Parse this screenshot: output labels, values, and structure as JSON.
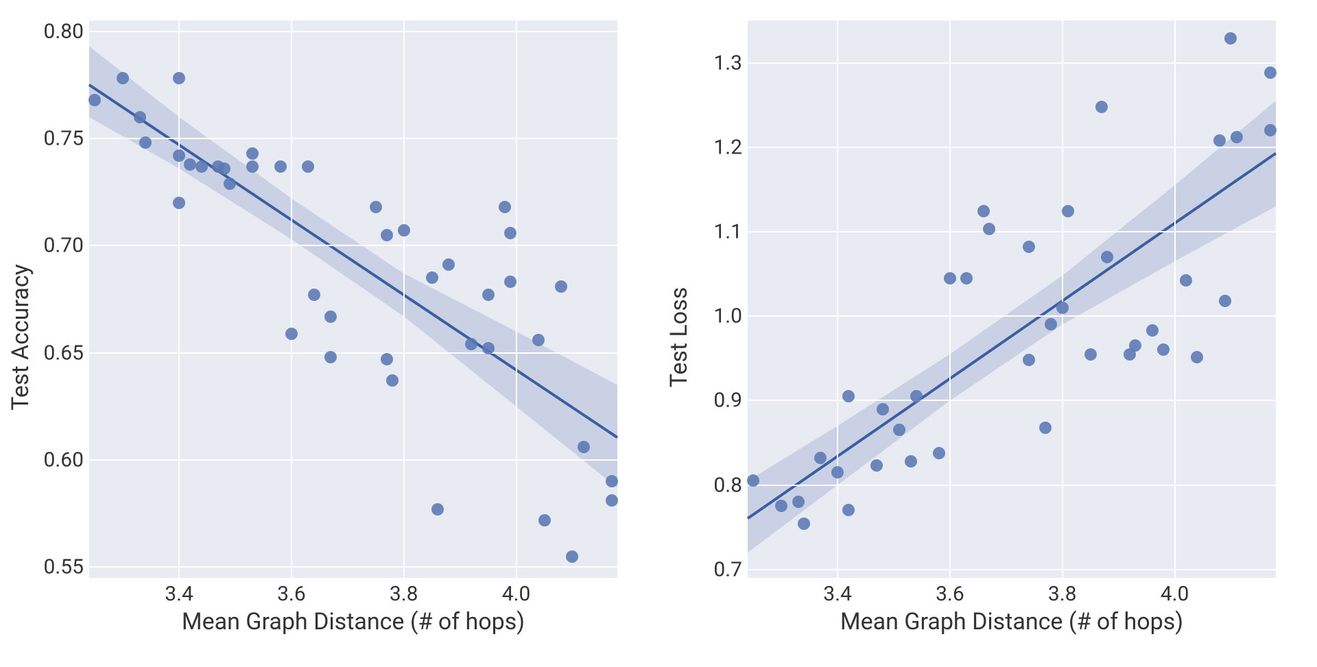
{
  "chart_data": [
    {
      "type": "scatter",
      "title": "",
      "xlabel": "Mean Graph Distance (# of hops)",
      "ylabel": "Test Accuracy",
      "xlim": [
        3.24,
        4.18
      ],
      "ylim": [
        0.545,
        0.805
      ],
      "xticks": [
        3.4,
        3.6,
        3.8,
        4.0
      ],
      "yticks": [
        0.55,
        0.6,
        0.65,
        0.7,
        0.75,
        0.8
      ],
      "xtick_labels": [
        "3.4",
        "3.6",
        "3.8",
        "4.0"
      ],
      "ytick_labels": [
        "0.55",
        "0.60",
        "0.65",
        "0.70",
        "0.75",
        "0.80"
      ],
      "regression": {
        "slope": -0.175,
        "intercept": 1.342
      },
      "ci_band": [
        {
          "x": 3.24,
          "lo": 0.76,
          "hi": 0.793
        },
        {
          "x": 3.4,
          "lo": 0.736,
          "hi": 0.76
        },
        {
          "x": 3.6,
          "lo": 0.703,
          "hi": 0.722
        },
        {
          "x": 3.8,
          "lo": 0.667,
          "hi": 0.687
        },
        {
          "x": 4.0,
          "lo": 0.625,
          "hi": 0.66
        },
        {
          "x": 4.18,
          "lo": 0.587,
          "hi": 0.635
        }
      ],
      "points": [
        {
          "x": 3.25,
          "y": 0.768
        },
        {
          "x": 3.3,
          "y": 0.778
        },
        {
          "x": 3.33,
          "y": 0.76
        },
        {
          "x": 3.34,
          "y": 0.748
        },
        {
          "x": 3.4,
          "y": 0.778
        },
        {
          "x": 3.4,
          "y": 0.742
        },
        {
          "x": 3.4,
          "y": 0.72
        },
        {
          "x": 3.42,
          "y": 0.738
        },
        {
          "x": 3.44,
          "y": 0.737
        },
        {
          "x": 3.47,
          "y": 0.737
        },
        {
          "x": 3.48,
          "y": 0.736
        },
        {
          "x": 3.49,
          "y": 0.729
        },
        {
          "x": 3.53,
          "y": 0.737
        },
        {
          "x": 3.53,
          "y": 0.743
        },
        {
          "x": 3.58,
          "y": 0.737
        },
        {
          "x": 3.6,
          "y": 0.659
        },
        {
          "x": 3.63,
          "y": 0.737
        },
        {
          "x": 3.64,
          "y": 0.677
        },
        {
          "x": 3.67,
          "y": 0.667
        },
        {
          "x": 3.67,
          "y": 0.648
        },
        {
          "x": 3.75,
          "y": 0.718
        },
        {
          "x": 3.77,
          "y": 0.705
        },
        {
          "x": 3.77,
          "y": 0.647
        },
        {
          "x": 3.78,
          "y": 0.637
        },
        {
          "x": 3.8,
          "y": 0.707
        },
        {
          "x": 3.85,
          "y": 0.685
        },
        {
          "x": 3.86,
          "y": 0.577
        },
        {
          "x": 3.88,
          "y": 0.691
        },
        {
          "x": 3.92,
          "y": 0.654
        },
        {
          "x": 3.95,
          "y": 0.677
        },
        {
          "x": 3.95,
          "y": 0.652
        },
        {
          "x": 3.98,
          "y": 0.718
        },
        {
          "x": 3.99,
          "y": 0.683
        },
        {
          "x": 3.99,
          "y": 0.706
        },
        {
          "x": 4.04,
          "y": 0.656
        },
        {
          "x": 4.05,
          "y": 0.572
        },
        {
          "x": 4.08,
          "y": 0.681
        },
        {
          "x": 4.1,
          "y": 0.555
        },
        {
          "x": 4.12,
          "y": 0.606
        },
        {
          "x": 4.17,
          "y": 0.59
        },
        {
          "x": 4.17,
          "y": 0.581
        }
      ]
    },
    {
      "type": "scatter",
      "title": "",
      "xlabel": "Mean Graph Distance (# of hops)",
      "ylabel": "Test Loss",
      "xlim": [
        3.24,
        4.18
      ],
      "ylim": [
        0.69,
        1.35
      ],
      "xticks": [
        3.4,
        3.6,
        3.8,
        4.0
      ],
      "yticks": [
        0.7,
        0.8,
        0.9,
        1.0,
        1.1,
        1.2,
        1.3
      ],
      "xtick_labels": [
        "3.4",
        "3.6",
        "3.8",
        "4.0"
      ],
      "ytick_labels": [
        "0.7",
        "0.8",
        "0.9",
        "1.0",
        "1.1",
        "1.2",
        "1.3"
      ],
      "regression": {
        "slope": 0.46,
        "intercept": -0.73
      },
      "ci_band": [
        {
          "x": 3.24,
          "lo": 0.72,
          "hi": 0.805
        },
        {
          "x": 3.4,
          "lo": 0.8,
          "hi": 0.87
        },
        {
          "x": 3.6,
          "lo": 0.9,
          "hi": 0.955
        },
        {
          "x": 3.8,
          "lo": 0.99,
          "hi": 1.048
        },
        {
          "x": 4.0,
          "lo": 1.065,
          "hi": 1.155
        },
        {
          "x": 4.18,
          "lo": 1.13,
          "hi": 1.255
        }
      ],
      "points": [
        {
          "x": 3.25,
          "y": 0.805
        },
        {
          "x": 3.3,
          "y": 0.775
        },
        {
          "x": 3.33,
          "y": 0.78
        },
        {
          "x": 3.34,
          "y": 0.754
        },
        {
          "x": 3.37,
          "y": 0.832
        },
        {
          "x": 3.4,
          "y": 0.815
        },
        {
          "x": 3.42,
          "y": 0.77
        },
        {
          "x": 3.42,
          "y": 0.905
        },
        {
          "x": 3.47,
          "y": 0.823
        },
        {
          "x": 3.48,
          "y": 0.89
        },
        {
          "x": 3.51,
          "y": 0.865
        },
        {
          "x": 3.53,
          "y": 0.828
        },
        {
          "x": 3.54,
          "y": 0.905
        },
        {
          "x": 3.58,
          "y": 0.838
        },
        {
          "x": 3.6,
          "y": 1.045
        },
        {
          "x": 3.63,
          "y": 1.045
        },
        {
          "x": 3.66,
          "y": 1.124
        },
        {
          "x": 3.67,
          "y": 1.103
        },
        {
          "x": 3.74,
          "y": 0.948
        },
        {
          "x": 3.74,
          "y": 1.082
        },
        {
          "x": 3.77,
          "y": 0.868
        },
        {
          "x": 3.78,
          "y": 0.99
        },
        {
          "x": 3.8,
          "y": 1.01
        },
        {
          "x": 3.81,
          "y": 1.124
        },
        {
          "x": 3.85,
          "y": 0.955
        },
        {
          "x": 3.87,
          "y": 1.248
        },
        {
          "x": 3.88,
          "y": 1.07
        },
        {
          "x": 3.92,
          "y": 0.955
        },
        {
          "x": 3.93,
          "y": 0.965
        },
        {
          "x": 3.96,
          "y": 0.983
        },
        {
          "x": 3.98,
          "y": 0.96
        },
        {
          "x": 4.02,
          "y": 1.042
        },
        {
          "x": 4.04,
          "y": 0.951
        },
        {
          "x": 4.08,
          "y": 1.208
        },
        {
          "x": 4.09,
          "y": 1.018
        },
        {
          "x": 4.1,
          "y": 1.329
        },
        {
          "x": 4.11,
          "y": 1.212
        },
        {
          "x": 4.17,
          "y": 1.288
        },
        {
          "x": 4.17,
          "y": 1.22
        }
      ]
    }
  ]
}
